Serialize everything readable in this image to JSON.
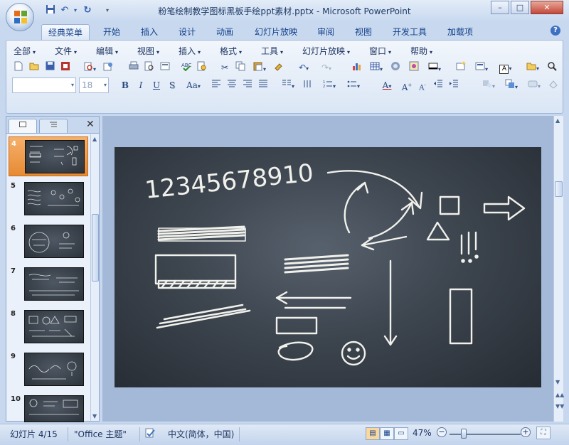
{
  "window": {
    "title": "粉笔绘制教学图标黑板手绘ppt素材.pptx - Microsoft PowerPoint",
    "min_label": "–",
    "max_label": "□",
    "close_label": "✕"
  },
  "tabs": [
    {
      "label": "经典菜单",
      "active": true
    },
    {
      "label": "开始"
    },
    {
      "label": "插入"
    },
    {
      "label": "设计"
    },
    {
      "label": "动画"
    },
    {
      "label": "幻灯片放映"
    },
    {
      "label": "审阅"
    },
    {
      "label": "视图"
    },
    {
      "label": "开发工具"
    },
    {
      "label": "加载项"
    }
  ],
  "menu": [
    "全部",
    "文件",
    "编辑",
    "视图",
    "插入",
    "格式",
    "工具",
    "幻灯片放映",
    "窗口",
    "帮助"
  ],
  "font": {
    "name_value": "",
    "size_value": "18"
  },
  "format_buttons": {
    "bold": "B",
    "italic": "I",
    "underline": "U",
    "shadow": "S",
    "case": "Aa",
    "font_color": "A"
  },
  "thumbnails": [
    {
      "num": "4",
      "selected": true
    },
    {
      "num": "5"
    },
    {
      "num": "6"
    },
    {
      "num": "7"
    },
    {
      "num": "8"
    },
    {
      "num": "9"
    },
    {
      "num": "10"
    }
  ],
  "slide": {
    "numbers_text": "12345678910",
    "exclaim_text": "!!!"
  },
  "status": {
    "slide_info": "幻灯片 4/15",
    "theme": "\"Office 主题\"",
    "language": "中文(简体，中国)",
    "zoom": "47%"
  },
  "colors": {
    "ribbon_bg": "#dae6f5",
    "selected_thumb": "#e68a33",
    "chalkboard": "#3d454f"
  }
}
